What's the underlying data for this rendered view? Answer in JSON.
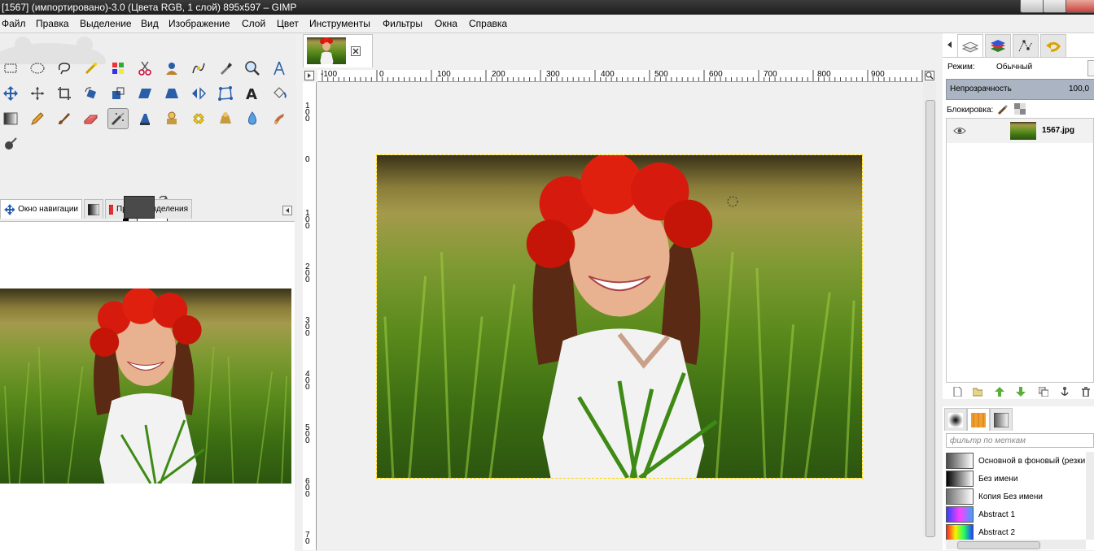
{
  "window": {
    "title": "[1567] (импортировано)-3.0 (Цвета RGB, 1 слой) 895x597 – GIMP"
  },
  "menu": [
    "Файл",
    "Правка",
    "Выделение",
    "Вид",
    "Изображение",
    "Слой",
    "Цвет",
    "Инструменты",
    "Фильтры",
    "Окна",
    "Справка"
  ],
  "toolbox": {
    "tools": [
      "rect-select-icon",
      "ellipse-select-icon",
      "lasso-icon",
      "fuzzy-select-icon",
      "color-select-icon",
      "scissors-icon",
      "foreground-select-icon",
      "paths-icon",
      "color-picker-icon",
      "zoom-icon",
      "measure-icon",
      "move-icon",
      "align-icon",
      "crop-icon",
      "rotate-icon",
      "scale-icon",
      "shear-icon",
      "perspective-icon",
      "flip-icon",
      "cage-icon",
      "text-icon",
      "bucket-fill-icon",
      "blend-icon",
      "pencil-icon",
      "paintbrush-icon",
      "eraser-icon",
      "airbrush-icon",
      "ink-icon",
      "clone-icon",
      "heal-icon",
      "perspective-clone-icon",
      "blur-icon",
      "smudge-icon",
      "dodge-burn-icon"
    ],
    "active_tool": "airbrush-icon",
    "fg_color": "#4a4a4a",
    "bg_color": "#ffffff"
  },
  "dock_tabs": {
    "navigation": "Окно навигации",
    "selection_editor": "Правка выделения"
  },
  "rulers": {
    "h_ticks": [
      "-100",
      "0",
      "100",
      "200",
      "300",
      "400",
      "500",
      "600",
      "700",
      "800",
      "900"
    ],
    "v_ticks": [
      "1\n0\n0",
      "0",
      "1\n0\n0",
      "2\n0\n0",
      "3\n0\n0",
      "4\n0\n0",
      "5\n0\n0",
      "6\n0\n0",
      "7\n0"
    ]
  },
  "layers": {
    "mode_label": "Режим:",
    "mode_value": "Обычный",
    "opacity_label": "Непрозрачность",
    "opacity_value": "100,0",
    "lock_label": "Блокировка:",
    "layer_name": "1567.jpg"
  },
  "gradients": {
    "filter_placeholder": "фильтр по меткам",
    "items": [
      {
        "name": "Основной в фоновый (резки",
        "swatch": "linear-gradient(90deg,#4a4a4a,#ffffff)"
      },
      {
        "name": "Без имени",
        "swatch": "linear-gradient(90deg,#000000,#ffffff)"
      },
      {
        "name": "Копия Без имени",
        "swatch": "linear-gradient(90deg,#6e6e6e,#ffffff)"
      },
      {
        "name": "Abstract 1",
        "swatch": "linear-gradient(90deg,#3040ff,#ff40ff,#40a0ff)"
      },
      {
        "name": "Abstract 2",
        "swatch": "linear-gradient(90deg,#ff2020,#ffee00,#20ff60,#2040ff)"
      }
    ]
  }
}
